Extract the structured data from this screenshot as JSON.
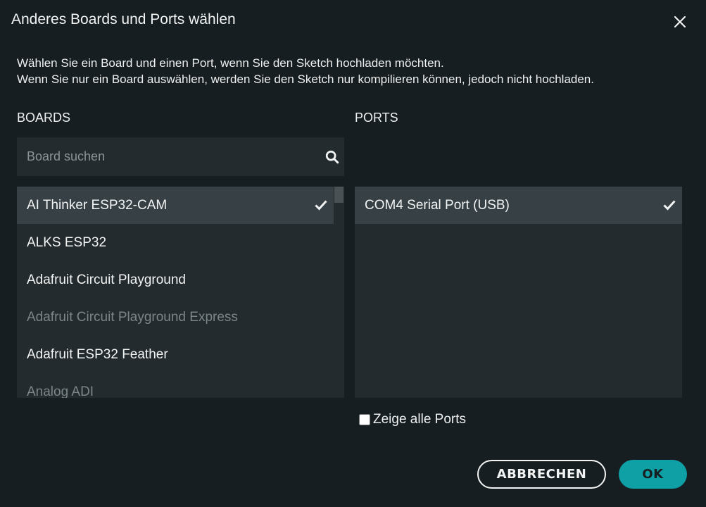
{
  "dialog": {
    "title": "Anderes Boards und Ports wählen",
    "description_line1": "Wählen Sie ein Board und einen Port, wenn Sie den Sketch hochladen möchten.",
    "description_line2": "Wenn Sie nur ein Board auswählen, werden Sie den Sketch nur kompilieren können, jedoch nicht hochladen."
  },
  "boards": {
    "label": "BOARDS",
    "search_placeholder": "Board suchen",
    "search_value": "",
    "items": [
      {
        "label": "AI Thinker ESP32-CAM",
        "selected": true,
        "disabled": false
      },
      {
        "label": "ALKS ESP32",
        "selected": false,
        "disabled": false
      },
      {
        "label": "Adafruit Circuit Playground",
        "selected": false,
        "disabled": false
      },
      {
        "label": "Adafruit Circuit Playground Express",
        "selected": false,
        "disabled": true
      },
      {
        "label": "Adafruit ESP32 Feather",
        "selected": false,
        "disabled": false
      },
      {
        "label": "Analog ADI",
        "selected": false,
        "disabled": true
      }
    ]
  },
  "ports": {
    "label": "PORTS",
    "items": [
      {
        "label": "COM4 Serial Port (USB)",
        "selected": true
      }
    ],
    "show_all_label": "Zeige alle Ports",
    "show_all_checked": false
  },
  "buttons": {
    "cancel_label": "ABBRECHEN",
    "ok_label": "OK"
  },
  "icons": {
    "close": "close-icon",
    "search": "search-icon",
    "check": "checkmark-icon"
  },
  "colors": {
    "background": "#171e21",
    "panel": "#232b2e",
    "selected_row": "#374045",
    "accent": "#0fa0a6",
    "text": "#f2f4f4",
    "muted_text": "#7c8588"
  }
}
